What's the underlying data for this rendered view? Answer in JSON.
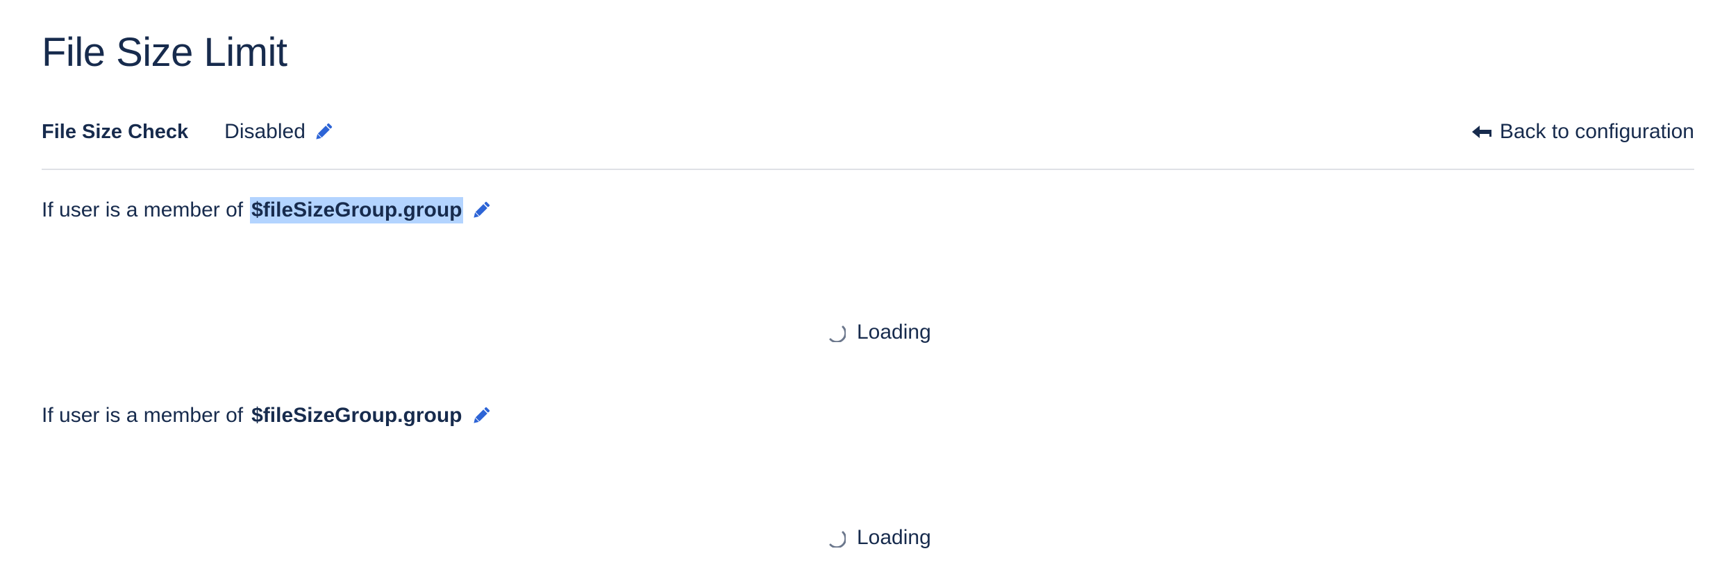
{
  "page": {
    "title": "File Size Limit"
  },
  "file_size_check": {
    "label": "File Size Check",
    "status": "Disabled",
    "edit_icon": "pencil-icon"
  },
  "navigation": {
    "back_label": "Back to configuration",
    "back_icon": "arrow-back-icon"
  },
  "rules": [
    {
      "prefix": "If user is a member of",
      "group": "$fileSizeGroup.group",
      "loading_label": "Loading"
    },
    {
      "prefix": "If user is a member of",
      "group": "$fileSizeGroup.group",
      "loading_label": "Loading"
    }
  ],
  "colors": {
    "text": "#172B4D",
    "accent": "#2D64D6",
    "selection": "#B3D4FF",
    "divider": "#DFE1E6",
    "spinner": "#6B778C"
  }
}
